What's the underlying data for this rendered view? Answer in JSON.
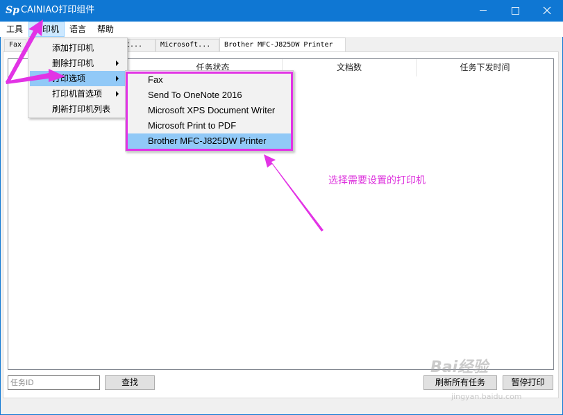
{
  "window": {
    "title": "CAINIAO打印组件",
    "icon": "app-logo-icon"
  },
  "menubar": {
    "items": [
      {
        "label": "工具"
      },
      {
        "label": "打印机"
      },
      {
        "label": "语言"
      },
      {
        "label": "帮助"
      }
    ]
  },
  "tabs": [
    {
      "label": "Fax"
    },
    {
      "label": "t..."
    },
    {
      "label": "Microsoft..."
    },
    {
      "label": "Brother MFC-J825DW Printer"
    }
  ],
  "list": {
    "columns": [
      "任务状态",
      "文档数",
      "任务下发时间"
    ],
    "rows": []
  },
  "bottom": {
    "task_id_placeholder": "任务ID",
    "search_label": "查找",
    "refresh_label": "刷新所有任务",
    "pause_label": "暂停打印"
  },
  "printer_menu": {
    "items": [
      {
        "label": "添加打印机",
        "has_submenu": false
      },
      {
        "label": "删除打印机",
        "has_submenu": true
      },
      {
        "label": "打印选项",
        "has_submenu": true
      },
      {
        "label": "打印机首选项",
        "has_submenu": true
      },
      {
        "label": "刷新打印机列表",
        "has_submenu": false
      }
    ]
  },
  "print_options_submenu": {
    "items": [
      {
        "label": "Fax"
      },
      {
        "label": "Send To OneNote 2016"
      },
      {
        "label": "Microsoft XPS Document Writer"
      },
      {
        "label": "Microsoft Print to PDF"
      },
      {
        "label": "Brother MFC-J825DW Printer"
      }
    ],
    "selected": "Brother MFC-J825DW Printer"
  },
  "annotation": {
    "text": "选择需要设置的打印机"
  },
  "watermark": {
    "text": "Bai经验",
    "url": "jingyan.baidu.com"
  },
  "colors": {
    "titlebar": "#0f77d3",
    "menu_highlight": "#91c9f7",
    "annotation": "#e233e5"
  }
}
